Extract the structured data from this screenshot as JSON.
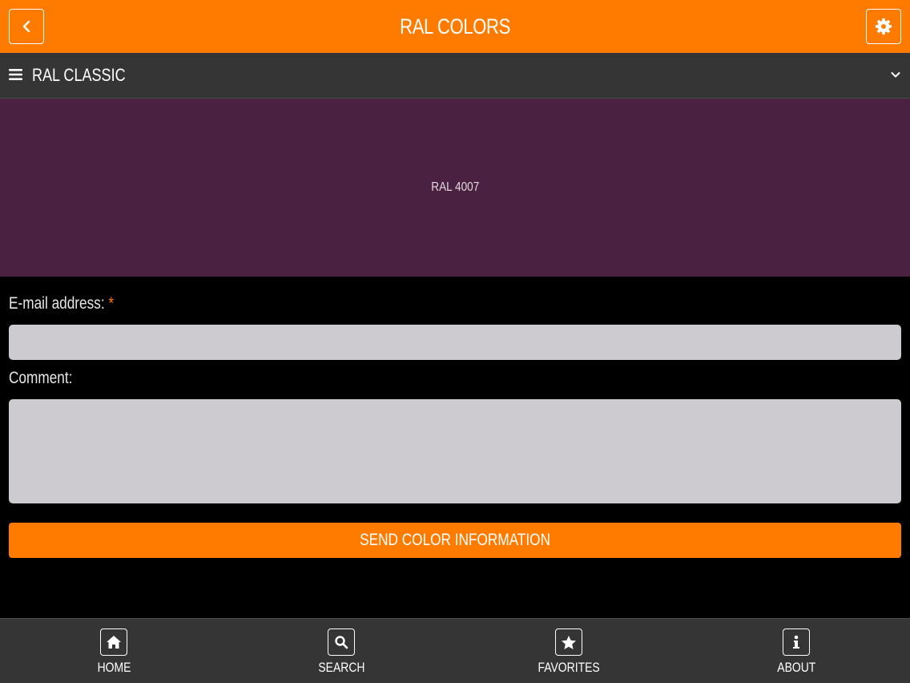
{
  "header": {
    "title": "RAL COLORS",
    "back_icon": "chevron-left-icon",
    "settings_icon": "gear-icon"
  },
  "category": {
    "label": "RAL CLASSIC",
    "menu_icon": "hamburger-menu-icon",
    "dropdown_icon": "chevron-down-icon"
  },
  "swatch": {
    "code": "RAL 4007",
    "color": "#4a2140"
  },
  "form": {
    "email_label": "E-mail address:",
    "required_marker": "*",
    "email_value": "",
    "comment_label": "Comment:",
    "comment_value": "",
    "send_label": "SEND COLOR INFORMATION"
  },
  "nav": {
    "items": [
      {
        "label": "HOME",
        "icon": "home-icon"
      },
      {
        "label": "SEARCH",
        "icon": "search-icon"
      },
      {
        "label": "FAVORITES",
        "icon": "star-icon"
      },
      {
        "label": "ABOUT",
        "icon": "info-icon"
      }
    ]
  },
  "colors": {
    "accent": "#ff7b00",
    "bar": "#353535",
    "background": "#000000",
    "field": "#cdcbcf"
  }
}
